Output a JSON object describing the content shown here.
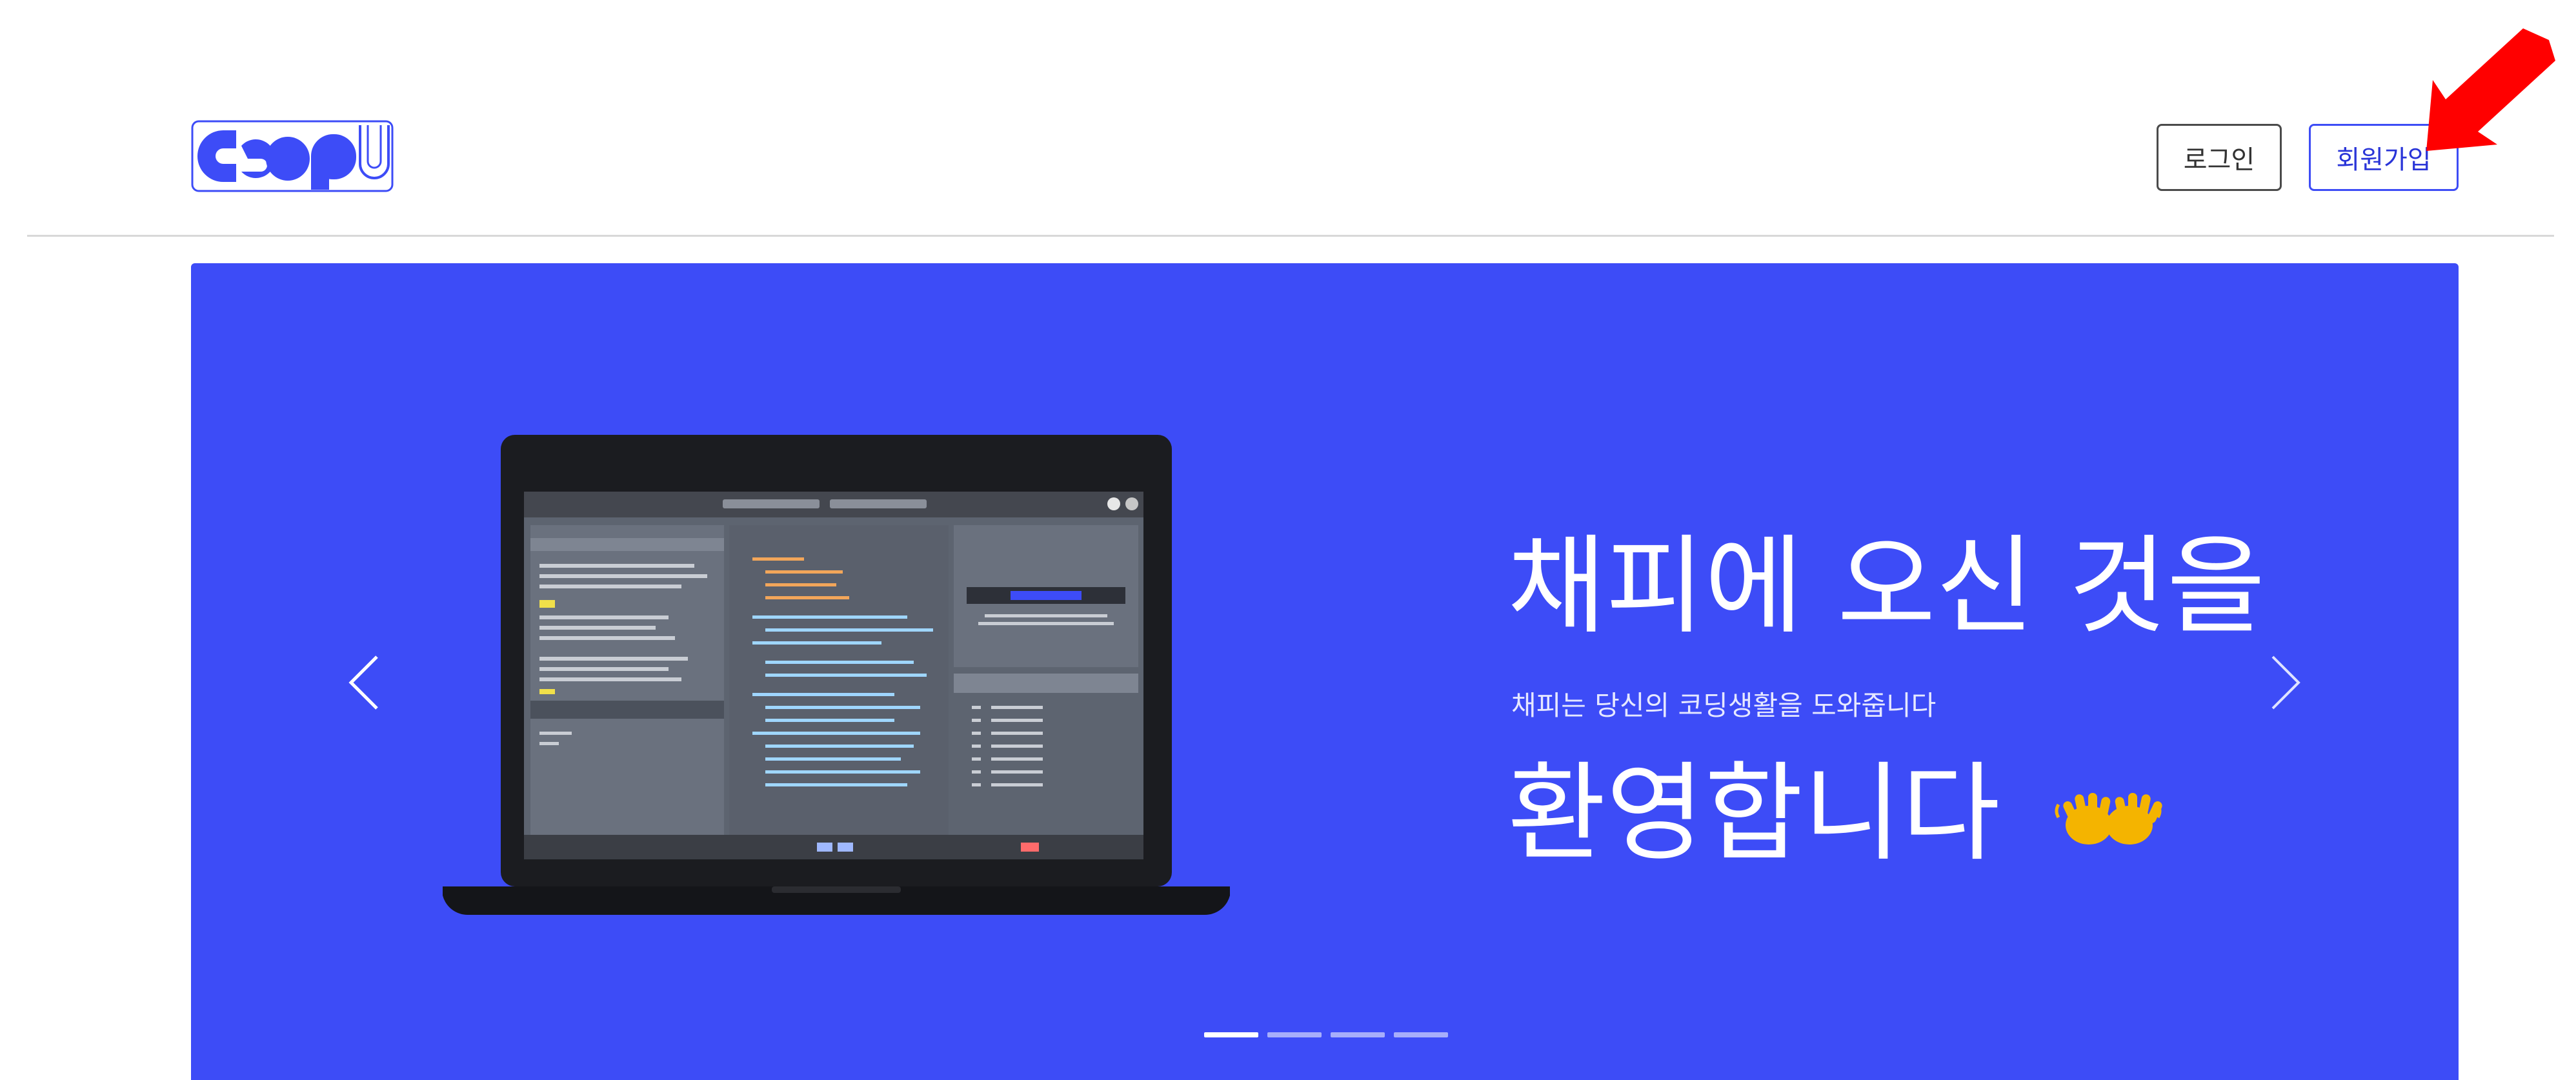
{
  "header": {
    "login_label": "로그인",
    "signup_label": "회원가입"
  },
  "hero": {
    "title_line1": "채피에 오신 것을",
    "title_line2": "환영합니다",
    "subtitle": "채피는 당신의 코딩생활을 도와줍니다",
    "emoji": "waving-hands-icon",
    "slides": 4,
    "active_slide": 1
  },
  "colors": {
    "brand_blue": "#3d4cf7",
    "annotation_red": "#ff0000"
  }
}
